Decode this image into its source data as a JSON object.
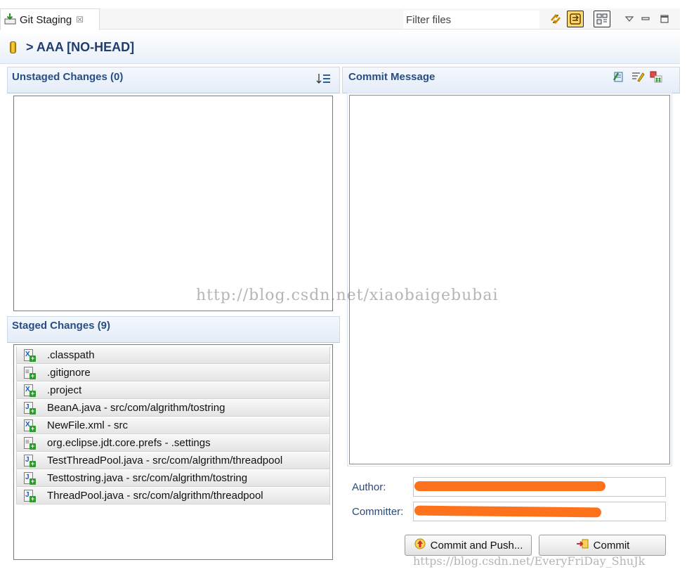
{
  "view": {
    "title": "Git Staging",
    "close_glyph": "☒"
  },
  "toolbar": {
    "filter_placeholder": "Filter files",
    "icons": [
      "sync-icon",
      "presentation-icon",
      "tree-layout-icon",
      "view-menu-icon",
      "minimize-icon",
      "maximize-icon"
    ]
  },
  "repo": {
    "title": "> AAA [NO-HEAD]"
  },
  "unstaged": {
    "title": "Unstaged Changes (0)",
    "files": []
  },
  "staged": {
    "title": "Staged Changes (9)",
    "files": [
      {
        "name": ".classpath",
        "icon": "xml-file-icon"
      },
      {
        "name": ".gitignore",
        "icon": "text-file-icon"
      },
      {
        "name": ".project",
        "icon": "xml-file-icon"
      },
      {
        "name": "BeanA.java - src/com/algrithm/tostring",
        "icon": "java-file-icon"
      },
      {
        "name": "NewFile.xml - src",
        "icon": "xml-file-icon"
      },
      {
        "name": "org.eclipse.jdt.core.prefs - .settings",
        "icon": "text-file-icon"
      },
      {
        "name": "TestThreadPool.java - src/com/algrithm/threadpool",
        "icon": "java-file-icon"
      },
      {
        "name": "Testtostring.java - src/com/algrithm/tostring",
        "icon": "java-file-icon"
      },
      {
        "name": "ThreadPool.java - src/com/algrithm/threadpool",
        "icon": "java-file-icon"
      }
    ]
  },
  "commit": {
    "title": "Commit Message",
    "message": "",
    "author_label": "Author:",
    "committer_label": "Committer:",
    "push_label": "Commit and Push...",
    "commit_label": "Commit"
  },
  "watermarks": {
    "center": "http://blog.csdn.net/xiaobaigebubai",
    "bottom": "https://blog.csdn.net/EveryFriDay_ShuJk"
  },
  "colors": {
    "header_text": "#274e86",
    "redaction": "#ff6a10"
  }
}
